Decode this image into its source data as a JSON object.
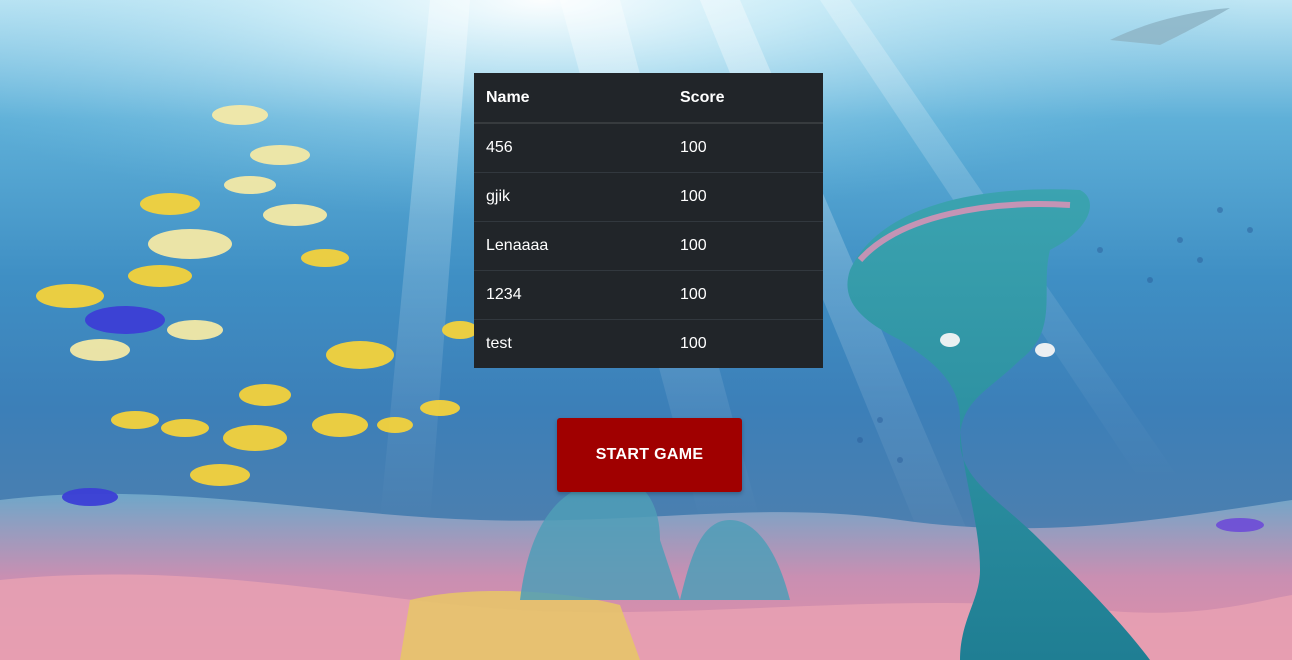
{
  "leaderboard": {
    "headers": {
      "name": "Name",
      "score": "Score"
    },
    "rows": [
      {
        "name": "456",
        "score": "100"
      },
      {
        "name": "gjik",
        "score": "100"
      },
      {
        "name": "Lenaaaa",
        "score": "100"
      },
      {
        "name": "1234",
        "score": "100"
      },
      {
        "name": "test",
        "score": "100"
      }
    ]
  },
  "start_button": {
    "label": "START GAME"
  },
  "colors": {
    "table_bg": "#212529",
    "button_bg": "#a00000",
    "text": "#ffffff"
  }
}
